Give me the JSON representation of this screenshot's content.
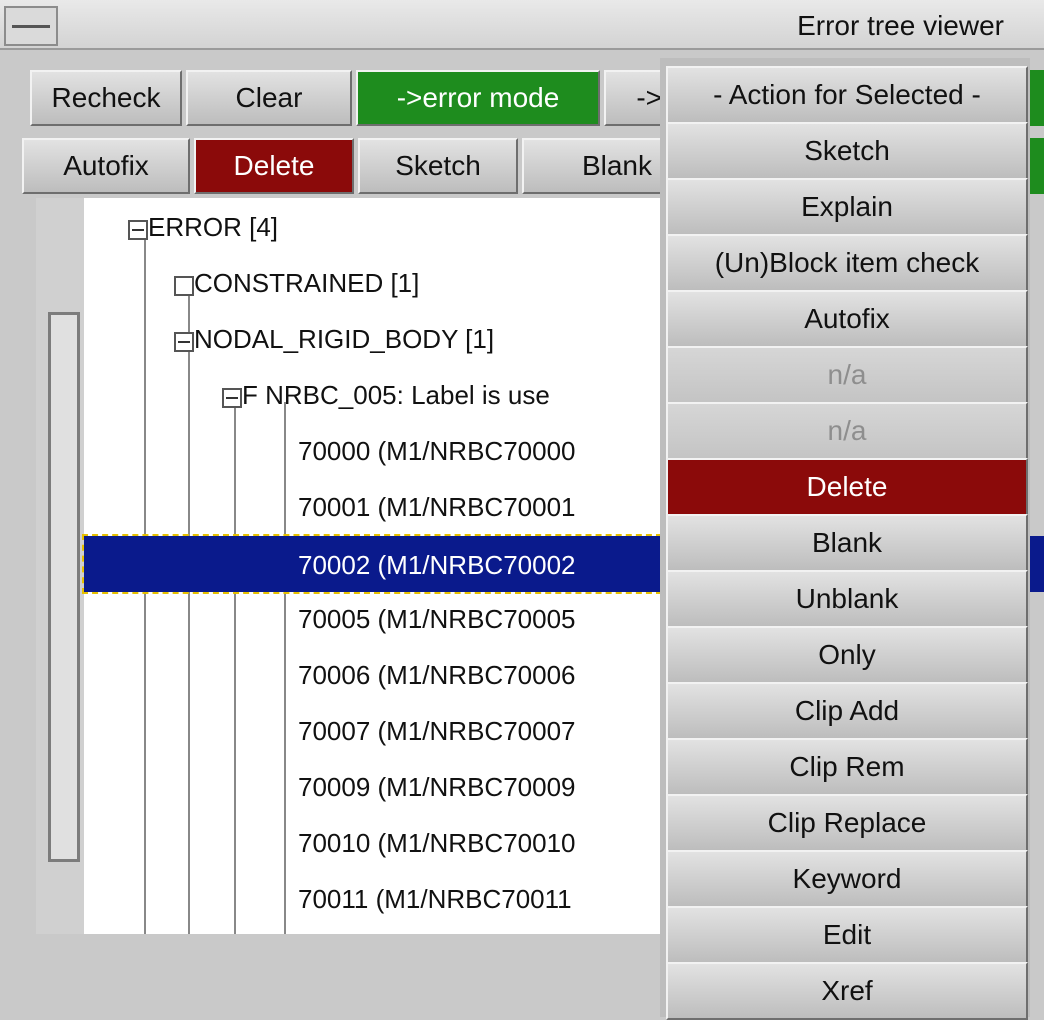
{
  "window": {
    "title": "Error tree viewer"
  },
  "toolbar1": {
    "recheck": "Recheck",
    "clear": "Clear",
    "error_mode": "->error mode",
    "arrow_partial": "->"
  },
  "toolbar2": {
    "autofix": "Autofix",
    "delete": "Delete",
    "sketch": "Sketch",
    "blank": "Blank"
  },
  "tree": {
    "rows": [
      {
        "label": "ERROR [4]",
        "state": "expanded"
      },
      {
        "label": "CONSTRAINED [1]",
        "state": "collapsed"
      },
      {
        "label": "NODAL_RIGID_BODY [1]",
        "state": "expanded"
      },
      {
        "label": "F NRBC_005: Label is use",
        "state": "expanded"
      },
      {
        "label": "70000 (M1/NRBC70000"
      },
      {
        "label": "70001 (M1/NRBC70001"
      },
      {
        "label": "70002 (M1/NRBC70002",
        "selected": true
      },
      {
        "label": "70005 (M1/NRBC70005"
      },
      {
        "label": "70006 (M1/NRBC70006"
      },
      {
        "label": "70007 (M1/NRBC70007"
      },
      {
        "label": "70009 (M1/NRBC70009"
      },
      {
        "label": "70010 (M1/NRBC70010"
      },
      {
        "label": "70011 (M1/NRBC70011"
      }
    ]
  },
  "menu": {
    "title": "- Action for Selected -",
    "items": [
      {
        "label": "Sketch"
      },
      {
        "label": "Explain"
      },
      {
        "label": "(Un)Block item check"
      },
      {
        "label": "Autofix"
      },
      {
        "label": "n/a",
        "disabled": true
      },
      {
        "label": "n/a",
        "disabled": true
      },
      {
        "label": "Delete",
        "accent": "#8b0a0a"
      },
      {
        "label": "Blank"
      },
      {
        "label": "Unblank"
      },
      {
        "label": "Only"
      },
      {
        "label": "Clip Add"
      },
      {
        "label": "Clip Rem"
      },
      {
        "label": "Clip Replace"
      },
      {
        "label": "Keyword"
      },
      {
        "label": "Edit"
      },
      {
        "label": "Xref"
      }
    ]
  },
  "colors": {
    "error_mode": "#1e8c1e",
    "delete": "#8b0a0a",
    "selection": "#0a1a8c"
  }
}
